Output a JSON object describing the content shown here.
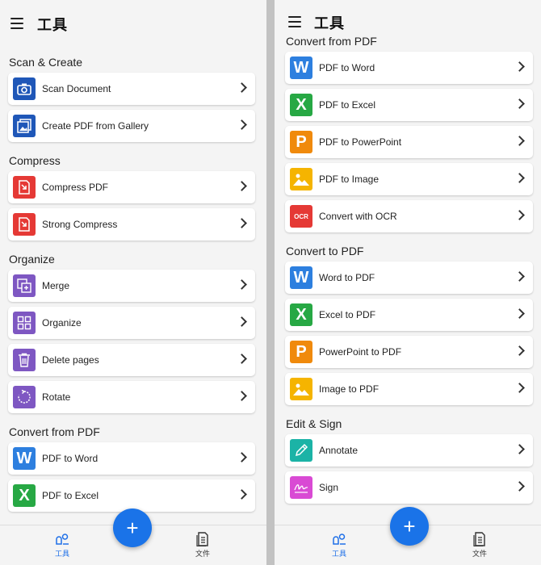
{
  "app": {
    "title": "工具"
  },
  "left": {
    "sections": [
      {
        "title": "Scan & Create",
        "items": [
          "Scan Document",
          "Create PDF from Gallery"
        ]
      },
      {
        "title": "Compress",
        "items": [
          "Compress PDF",
          "Strong Compress"
        ]
      },
      {
        "title": "Organize",
        "items": [
          "Merge",
          "Organize",
          "Delete pages",
          "Rotate"
        ]
      },
      {
        "title": "Convert from PDF",
        "items": [
          "PDF to Word",
          "PDF to Excel"
        ]
      }
    ]
  },
  "right": {
    "sections": [
      {
        "title": "Convert from PDF",
        "items": [
          "PDF to Word",
          "PDF to Excel",
          "PDF to PowerPoint",
          "PDF to Image",
          "Convert with OCR"
        ]
      },
      {
        "title": "Convert to PDF",
        "items": [
          "Word to PDF",
          "Excel to PDF",
          "PowerPoint to PDF",
          "Image to PDF"
        ]
      },
      {
        "title": "Edit & Sign",
        "items": [
          "Annotate",
          "Sign"
        ]
      }
    ]
  },
  "icons": {
    "word": "W",
    "excel": "X",
    "ppt": "P",
    "ocr": "OCR"
  },
  "bottom_nav": {
    "tools_label": "工具",
    "files_label": "文件"
  },
  "fab_label": "+",
  "colors": {
    "accent": "#1a73e8",
    "scan": "#1f57b8",
    "compress": "#e53935",
    "organize": "#7e57c2",
    "word": "#2d7fdf",
    "excel": "#27a844",
    "ppt": "#f08a0c",
    "image": "#f5b400"
  }
}
